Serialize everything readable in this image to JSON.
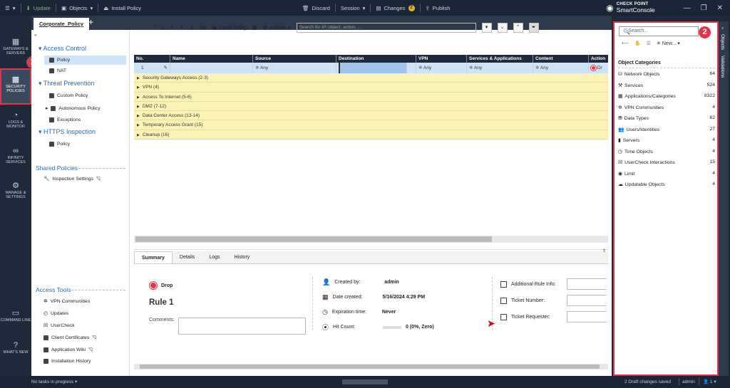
{
  "topbar": {
    "update": "Update",
    "objects": "Objects",
    "install_policy": "Install Policy",
    "discard": "Discard",
    "session": "Session",
    "changes": "Changes",
    "changes_count": "2",
    "publish": "Publish",
    "brand_top": "CHECK POINT",
    "brand_bottom": "SmartConsole"
  },
  "leftnav": {
    "gateways": "GATEWAYS & SERVERS",
    "security": "SECURITY POLICIES",
    "logs": "LOGS & MONITOR",
    "infinity": "INFINITY SERVICES",
    "manage": "MANAGE & SETTINGS",
    "cmdline": "COMMAND LINE",
    "whatsnew": "WHAT'S NEW"
  },
  "doc_tab": "Corporate_Policy",
  "tree": {
    "access_control": "Access Control",
    "policy": "Policy",
    "nat": "NAT",
    "threat_prevention": "Threat Prevention",
    "custom_policy": "Custom Policy",
    "autonomous_policy": "Autonomous Policy",
    "exceptions": "Exceptions",
    "https_inspection": "HTTPS Inspection",
    "https_policy": "Policy",
    "shared_policies": "Shared Policies",
    "inspection_settings": "Inspection Settings",
    "access_tools": "Access Tools",
    "tools": [
      "VPN Communities",
      "Updates",
      "UserCheck",
      "Client Certificates",
      "Application Wiki",
      "Installation History"
    ]
  },
  "toolbar": {
    "install_policy": "Install Policy",
    "actions": "Actions",
    "search_placeholder": "Search for IP, object, action, ..."
  },
  "table": {
    "headers": [
      "No.",
      "Name",
      "Source",
      "Destination",
      "VPN",
      "Services & Applications",
      "Content",
      "Action"
    ],
    "row": {
      "no": "1",
      "source": "Any",
      "vpn": "Any",
      "services": "Any",
      "content": "Any",
      "action": "Dr"
    },
    "sections": [
      "Security Gateways Access (2-3)",
      "VPN (4)",
      "Access To Internet (5-6)",
      "DMZ (7-12)",
      "Data Center Access (13-14)",
      "Temporary Access Grant (15)",
      "Cleanup (16)"
    ]
  },
  "details": {
    "tabs": [
      "Summary",
      "Details",
      "Logs",
      "History"
    ],
    "action": "Drop",
    "rule": "Rule 1",
    "comments_label": "Comments:",
    "created_by_label": "Created by:",
    "created_by": "admin",
    "date_label": "Date created:",
    "date": "5/16/2024 4:29 PM",
    "expiration_label": "Expiration time:",
    "expiration": "Never",
    "hit_label": "Hit Count:",
    "hit": "0 (0%, Zero)",
    "additional_label": "Additional Rule Info:",
    "ticket_number_label": "Ticket Number:",
    "ticket_requester_label": "Ticket Requester:"
  },
  "objects": {
    "search_placeholder": "Search...",
    "new_label": "New...",
    "categories_title": "Object Categories",
    "categories": [
      {
        "name": "Network Objects",
        "count": "64"
      },
      {
        "name": "Services",
        "count": "524"
      },
      {
        "name": "Applications/Categories",
        "count": "8322"
      },
      {
        "name": "VPN Communities",
        "count": "4"
      },
      {
        "name": "Data Types",
        "count": "62"
      },
      {
        "name": "Users/Identities",
        "count": "27"
      },
      {
        "name": "Servers",
        "count": "4"
      },
      {
        "name": "Time Objects",
        "count": "4"
      },
      {
        "name": "UserCheck Interactions",
        "count": "15"
      },
      {
        "name": "Limit",
        "count": "4"
      },
      {
        "name": "Updatable Objects",
        "count": "4"
      }
    ],
    "vtab_objects": "Objects",
    "vtab_validations": "Validations"
  },
  "callouts": [
    "1",
    "2"
  ],
  "status": {
    "left": "No tasks in progress",
    "drafts": "2 Draft changes saved",
    "user": "admin",
    "sessions": "1"
  }
}
